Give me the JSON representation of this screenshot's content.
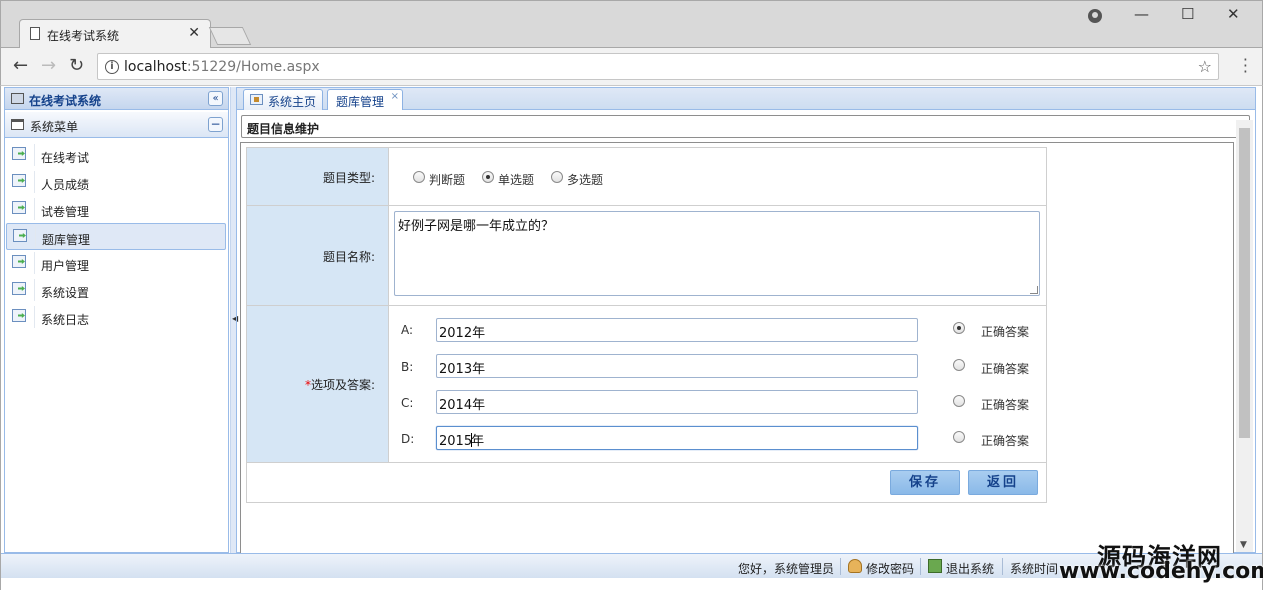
{
  "browser": {
    "tab_title": "在线考试系统",
    "tab_close": "✕",
    "url_host": "localhost",
    "url_rest": ":51229/Home.aspx",
    "back": "←",
    "forward": "→",
    "reload": "↻",
    "star": "☆",
    "minimize": "—",
    "maximize": "☐",
    "close": "✕"
  },
  "sidebar": {
    "title": "在线考试系统",
    "collapse": "«",
    "menu_title": "系统菜单",
    "menu_toggle": "−",
    "items": [
      {
        "label": "在线考试"
      },
      {
        "label": "人员成绩"
      },
      {
        "label": "试卷管理"
      },
      {
        "label": "题库管理",
        "selected": true
      },
      {
        "label": "用户管理"
      },
      {
        "label": "系统设置"
      },
      {
        "label": "系统日志"
      }
    ]
  },
  "tabs": [
    {
      "label": "系统主页"
    },
    {
      "label": "题库管理",
      "close": "×"
    }
  ],
  "form": {
    "title": "题目信息维护",
    "type_label": "题目类型:",
    "types": [
      {
        "label": "判断题",
        "checked": false
      },
      {
        "label": "单选题",
        "checked": true
      },
      {
        "label": "多选题",
        "checked": false
      }
    ],
    "name_label": "题目名称:",
    "name_value": "好例子网是哪一年成立的？",
    "options_required": "*",
    "options_label": "选项及答案:",
    "options": [
      {
        "letter": "A:",
        "value": "2012年",
        "correct": true
      },
      {
        "letter": "B:",
        "value": "2013年",
        "correct": false
      },
      {
        "letter": "C:",
        "value": "2014年",
        "correct": false
      },
      {
        "letter": "D:",
        "value_before_caret": "2015",
        "value_after_caret": "年",
        "correct": false
      }
    ],
    "correct_label": "正确答案",
    "save": "保存",
    "back": "返回"
  },
  "status": {
    "greeting": "您好，系统管理员",
    "change_password": "修改密码",
    "logout": "退出系统",
    "time_label": "系统时间"
  },
  "watermark": {
    "cn": "源码海洋网",
    "url": "www.codehy.com"
  }
}
